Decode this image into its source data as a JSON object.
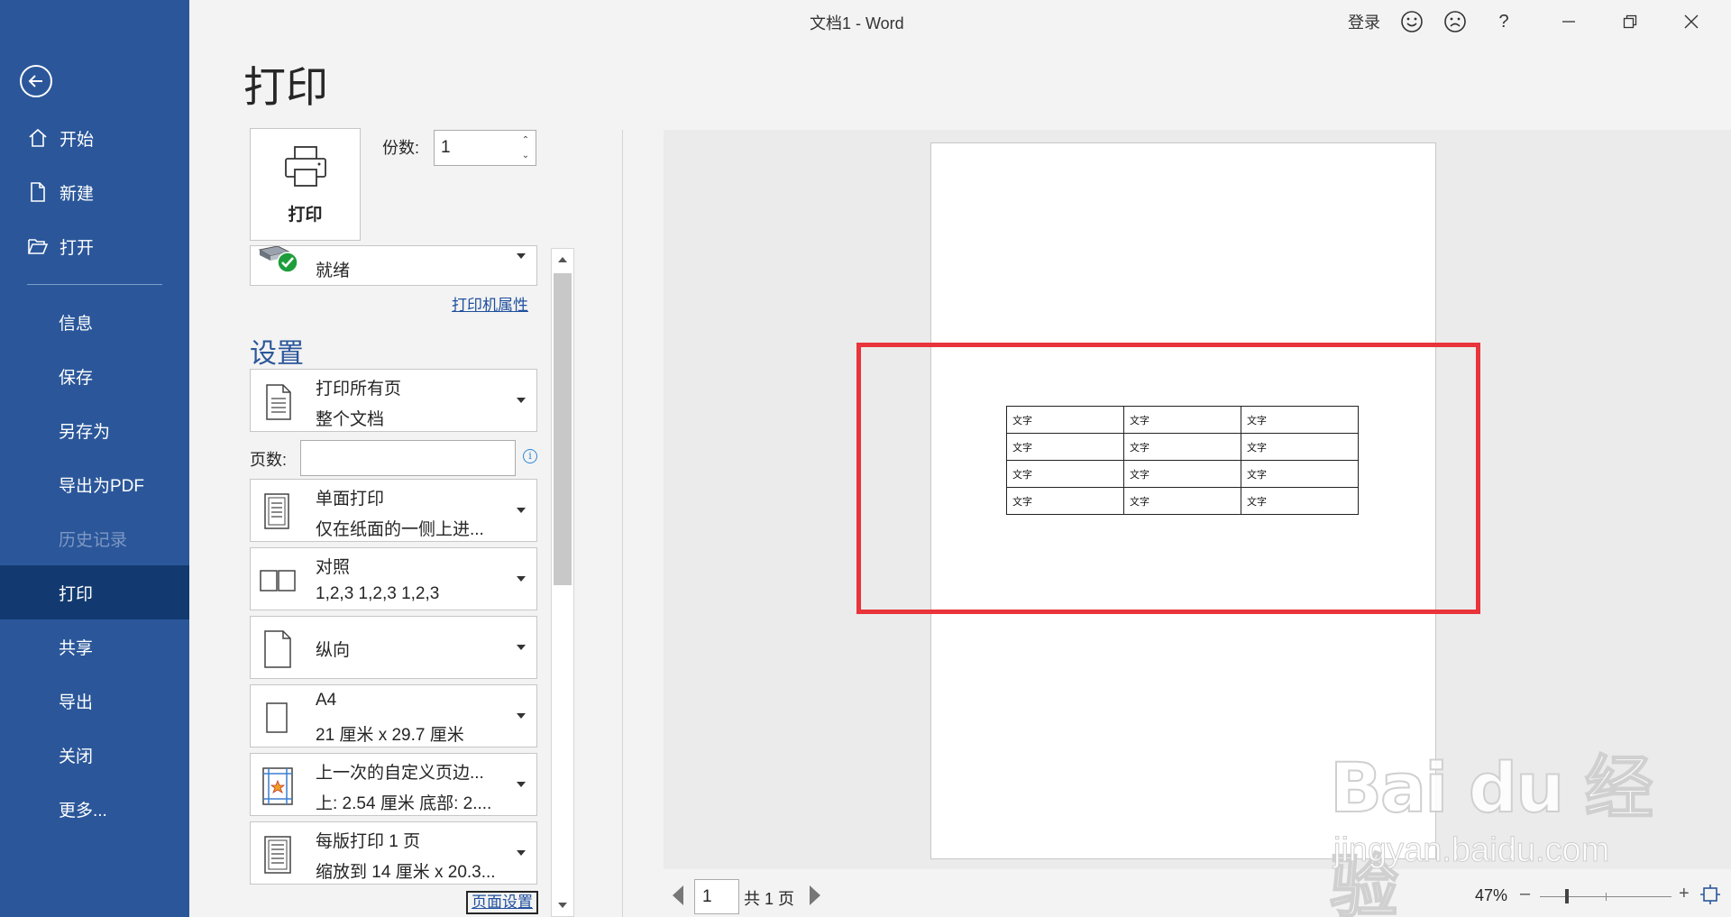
{
  "window": {
    "title": "文档1  -  Word",
    "signin": "登录",
    "help": "?"
  },
  "sidebar": {
    "items": [
      {
        "label": "开始",
        "icon": "home-icon"
      },
      {
        "label": "新建",
        "icon": "new-document-icon"
      },
      {
        "label": "打开",
        "icon": "open-folder-icon"
      },
      {
        "label": "信息"
      },
      {
        "label": "保存"
      },
      {
        "label": "另存为"
      },
      {
        "label": "导出为PDF"
      },
      {
        "label": "历史记录",
        "disabled": true
      },
      {
        "label": "打印",
        "active": true
      },
      {
        "label": "共享"
      },
      {
        "label": "导出"
      },
      {
        "label": "关闭"
      },
      {
        "label": "更多..."
      }
    ]
  },
  "print": {
    "title": "打印",
    "button_label": "打印",
    "copies_label": "份数:",
    "copies_value": "1",
    "printer_status": "就绪",
    "printer_properties": "打印机属性",
    "settings_heading": "设置",
    "pages_label": "页数:",
    "pages_value": "",
    "page_setup": "页面设置",
    "settings": [
      {
        "line1": "打印所有页",
        "line2": "整个文档"
      },
      {
        "line1": "单面打印",
        "line2": "仅在纸面的一侧上进..."
      },
      {
        "line1": "对照",
        "line2": "1,2,3    1,2,3    1,2,3"
      },
      {
        "line1": "纵向",
        "line2": ""
      },
      {
        "line1": "A4",
        "line2": "21 厘米 x 29.7 厘米"
      },
      {
        "line1": "上一次的自定义页边...",
        "line2": "上: 2.54 厘米 底部: 2...."
      },
      {
        "line1": "每版打印 1 页",
        "line2": "缩放到 14 厘米 x 20.3..."
      }
    ]
  },
  "preview": {
    "table": [
      [
        "文字",
        "文字",
        "文字"
      ],
      [
        "文字",
        "文字",
        "文字"
      ],
      [
        "文字",
        "文字",
        "文字"
      ],
      [
        "文字",
        "文字",
        "文字"
      ]
    ],
    "highlight_color": "#e8343a",
    "page_number": "1",
    "page_total": "共 1 页",
    "zoom_level": "47%",
    "zoom_fraction": 0.47
  },
  "watermark": {
    "text": "Bai du 经验",
    "url": "jingyan.baidu.com"
  },
  "colors": {
    "sidebar": "#2b579a",
    "sidebar_active": "#133a70",
    "accent": "#2b579a"
  }
}
